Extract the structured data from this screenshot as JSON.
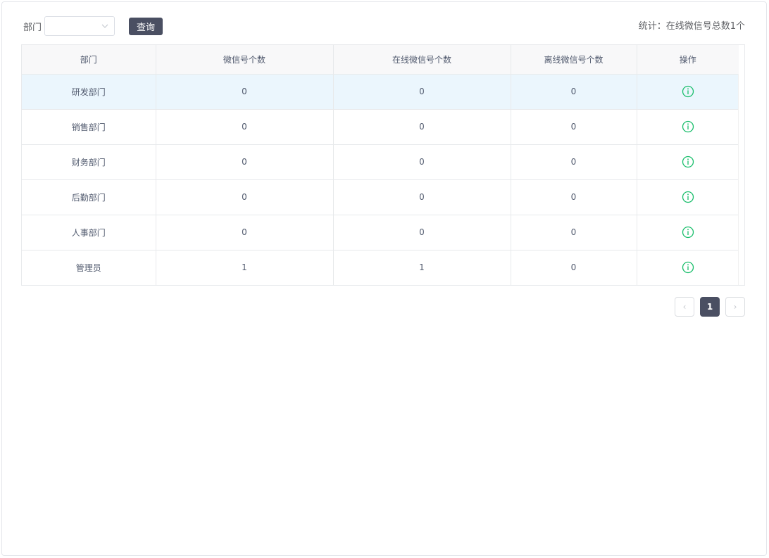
{
  "filter": {
    "dept_label": "部门",
    "dept_value": "",
    "query_button": "查询"
  },
  "stats": {
    "text": "统计：在线微信号总数1个"
  },
  "table": {
    "columns": [
      "部门",
      "微信号个数",
      "在线微信号个数",
      "离线微信号个数",
      "操作"
    ],
    "rows": [
      {
        "dept": "研发部门",
        "total": "0",
        "online": "0",
        "offline": "0"
      },
      {
        "dept": "销售部门",
        "total": "0",
        "online": "0",
        "offline": "0"
      },
      {
        "dept": "财务部门",
        "total": "0",
        "online": "0",
        "offline": "0"
      },
      {
        "dept": "后勤部门",
        "total": "0",
        "online": "0",
        "offline": "0"
      },
      {
        "dept": "人事部门",
        "total": "0",
        "online": "0",
        "offline": "0"
      },
      {
        "dept": "管理员",
        "total": "1",
        "online": "1",
        "offline": "0"
      }
    ],
    "action_icon": "info-circle-icon",
    "action_color": "#19be6b",
    "highlight_row": 0,
    "highlight_color": "#ebf6fd"
  },
  "pagination": {
    "prev": "‹",
    "current": "1",
    "next": "›"
  },
  "colors": {
    "button_bg": "#4a4f62",
    "header_bg": "#f8f8f9"
  }
}
